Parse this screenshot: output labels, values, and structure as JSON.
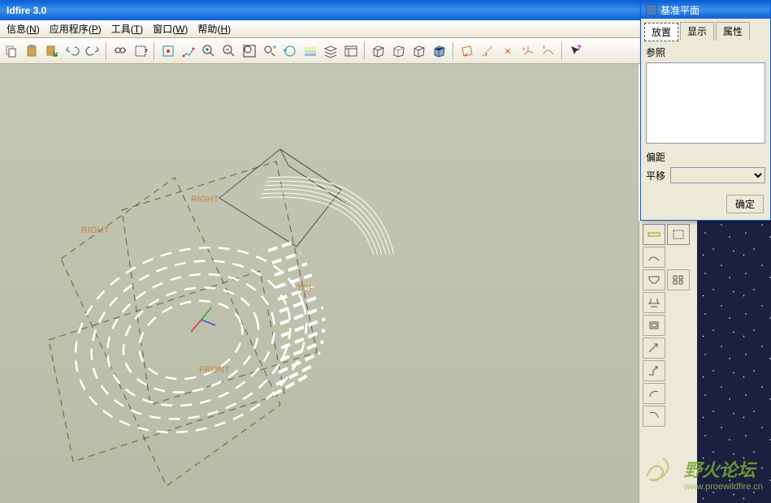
{
  "app": {
    "title": "ldfire 3.0"
  },
  "menu": {
    "items": [
      {
        "label": "信息",
        "key": "N"
      },
      {
        "label": "应用程序",
        "key": "P"
      },
      {
        "label": "工具",
        "key": "T"
      },
      {
        "label": "窗口",
        "key": "W"
      },
      {
        "label": "帮助",
        "key": "H"
      }
    ]
  },
  "toolbar": {
    "groups": [
      [
        "copy",
        "paste",
        "paste-special",
        "undo",
        "redo"
      ],
      [
        "find",
        "select-box"
      ],
      [
        "regen",
        "measure",
        "zoom-in",
        "zoom-out",
        "zoom-fit",
        "zoom-window",
        "refit",
        "named-views",
        "layers",
        "view-mgr"
      ],
      [
        "wireframe",
        "hidden-line",
        "no-hidden",
        "shaded"
      ],
      [
        "datum-plane",
        "datum-axis",
        "datum-point",
        "datum-csys",
        "datum-curve"
      ],
      [
        "help-cursor"
      ]
    ],
    "icons": {
      "copy": "copy",
      "paste": "paste",
      "paste-special": "paste-special",
      "undo": "undo",
      "redo": "redo",
      "find": "binoculars",
      "select-box": "select",
      "regen": "regen",
      "measure": "sketch",
      "zoom-in": "zoom-in",
      "zoom-out": "zoom-out",
      "zoom-fit": "zoom-fit",
      "zoom-window": "zoom-win",
      "refit": "refit",
      "named-views": "views",
      "layers": "layers",
      "view-mgr": "viewmgr",
      "wireframe": "cube-wire",
      "hidden-line": "cube-hidden",
      "no-hidden": "cube-nohide",
      "shaded": "cube-shade",
      "datum-plane": "dplane",
      "datum-axis": "daxis",
      "datum-point": "dpoint",
      "datum-csys": "dcsys",
      "datum-curve": "dcurve",
      "help-cursor": "help"
    }
  },
  "right_toolbar": {
    "rows": [
      [
        "feat-1",
        "feat-2"
      ],
      [
        "feat-3",
        ""
      ],
      [
        "feat-4",
        "feat-5"
      ],
      [
        "feat-6",
        ""
      ],
      [
        "feat-7",
        ""
      ],
      [
        "feat-8",
        ""
      ],
      [
        "feat-9",
        ""
      ],
      [
        "feat-10",
        ""
      ],
      [
        "feat-11",
        ""
      ]
    ]
  },
  "dialog": {
    "title": "基准平面",
    "tabs": [
      "放置",
      "显示",
      "属性"
    ],
    "active_tab": 0,
    "ref_label": "参照",
    "offset_label": "偏距",
    "translate_label": "平移",
    "translate_value": "",
    "ok": "确定",
    "cancel": ""
  },
  "datum": {
    "right": "RIGHT",
    "right2": "RIGHT",
    "top": "TOP",
    "front": "FRONT"
  },
  "watermark": {
    "title": "野火论坛",
    "url": "www.proewildfire.cn"
  }
}
